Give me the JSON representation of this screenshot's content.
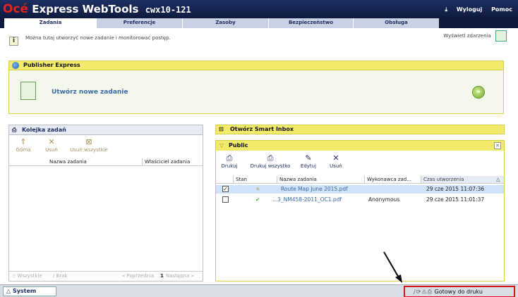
{
  "header": {
    "brand_oce": "Océ",
    "brand_product": "Express WebTools",
    "hostname": "cwx10-121",
    "logout_label": "Wyloguj",
    "help_label": "Pomoc"
  },
  "tabs": [
    {
      "label": "Zadania"
    },
    {
      "label": "Preferencje"
    },
    {
      "label": "Zasoby"
    },
    {
      "label": "Bezpieczeństwo"
    },
    {
      "label": "Obsługa"
    }
  ],
  "info": {
    "text": "Można tutaj utworzyć nowe zadanie i monitorować postęp.",
    "events_label": "Wyświetl zdarzenia"
  },
  "publisher": {
    "title": "Publisher Express",
    "new_job_label": "Utwórz nowe zadanie"
  },
  "queue": {
    "title": "Kolejka zadań",
    "toolbar": [
      "Górna",
      "Usuń",
      "Usuń wszystkie"
    ],
    "columns": [
      "Nazwa zadania",
      "Właściciel zadania"
    ],
    "footer": {
      "all": "Wszystkie",
      "none": "Brak",
      "prev": "« Poprzednia",
      "page": "1",
      "next": "Następna »"
    }
  },
  "smart_inbox": {
    "title": "Otwórz Smart Inbox",
    "public_title": "Public",
    "toolbar": [
      "Drukuj",
      "Drukuj wszystko",
      "Edytuj",
      "Usuń"
    ],
    "columns": [
      "Stan",
      "Nazwa zadania",
      "Wykonawca zad...",
      "Czas utworzenia"
    ],
    "rows": [
      {
        "checked": true,
        "state": "processing",
        "name": "Route Map June 2015.pdf",
        "owner": "",
        "time": "29 cze 2015 11:07:36"
      },
      {
        "checked": false,
        "state": "done",
        "name": "...3_NM458-2011_OC1.pdf",
        "owner": "Anonymous",
        "time": "29 cze 2015 11:01:37"
      }
    ]
  },
  "statusbar": {
    "system_label": "System",
    "status_text": "Gotowy do druku"
  },
  "colors": {
    "header_bg": "#1d2f63",
    "accent_yellow": "#f2eb6a",
    "highlight_red": "#d3181d"
  }
}
